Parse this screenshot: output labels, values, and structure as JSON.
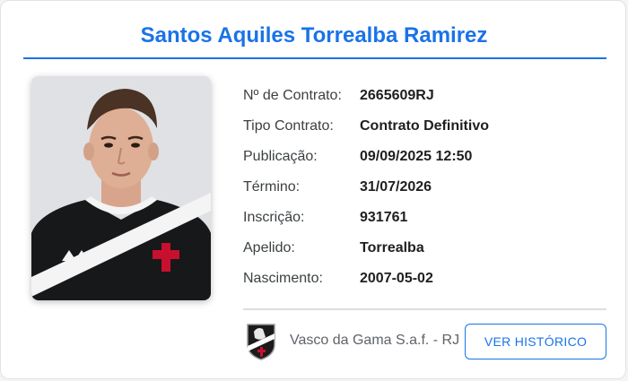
{
  "player": {
    "name": "Santos Aquiles Torrealba Ramirez"
  },
  "details": [
    {
      "label": "Nº de Contrato:",
      "value": "2665609RJ"
    },
    {
      "label": "Tipo Contrato:",
      "value": "Contrato Definitivo"
    },
    {
      "label": "Publicação:",
      "value": "09/09/2025 12:50"
    },
    {
      "label": "Término:",
      "value": "31/07/2026"
    },
    {
      "label": "Inscrição:",
      "value": "931761"
    },
    {
      "label": "Apelido:",
      "value": "Torrealba"
    },
    {
      "label": "Nascimento:",
      "value": "2007-05-02"
    }
  ],
  "club": {
    "name": "Vasco da Gama S.a.f. - RJ",
    "logo_icon": "vasco-crest-icon"
  },
  "actions": {
    "history_label": "VER HISTÓRICO"
  },
  "colors": {
    "accent": "#1a73e8",
    "separator": "#dcdde0",
    "label": "#3c4043",
    "value": "#1f1f1f"
  }
}
